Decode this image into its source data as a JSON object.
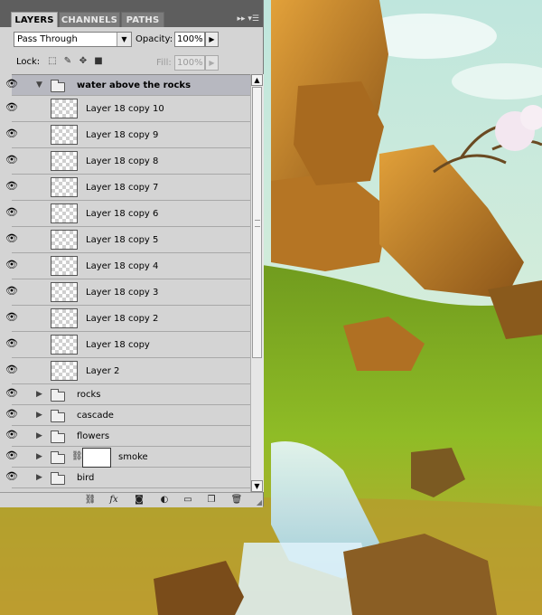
{
  "tabs": [
    {
      "label": "LAYERS",
      "active": true
    },
    {
      "label": "CHANNELS",
      "active": false
    },
    {
      "label": "PATHS",
      "active": false
    }
  ],
  "panel_menu_icon": "panel-menu-icon",
  "blend_mode": "Pass Through",
  "opacity": {
    "label": "Opacity:",
    "value": "100%"
  },
  "lock": {
    "label": "Lock:",
    "icons": [
      "lock-transparent-icon",
      "lock-brush-icon",
      "lock-move-icon",
      "lock-all-icon"
    ]
  },
  "fill": {
    "label": "Fill:",
    "value": "100%"
  },
  "layers": [
    {
      "type": "group",
      "name": "water above the rocks",
      "expanded": true,
      "selected": true,
      "visible": true
    },
    {
      "type": "layer",
      "name": "Layer 18 copy 10",
      "visible": true
    },
    {
      "type": "layer",
      "name": "Layer 18 copy 9",
      "visible": true
    },
    {
      "type": "layer",
      "name": "Layer 18 copy 8",
      "visible": true
    },
    {
      "type": "layer",
      "name": "Layer 18 copy 7",
      "visible": true
    },
    {
      "type": "layer",
      "name": "Layer 18 copy 6",
      "visible": true
    },
    {
      "type": "layer",
      "name": "Layer 18 copy 5",
      "visible": true
    },
    {
      "type": "layer",
      "name": "Layer 18 copy 4",
      "visible": true
    },
    {
      "type": "layer",
      "name": "Layer 18 copy 3",
      "visible": true
    },
    {
      "type": "layer",
      "name": "Layer 18 copy 2",
      "visible": true
    },
    {
      "type": "layer",
      "name": "Layer 18 copy",
      "visible": true
    },
    {
      "type": "layer",
      "name": "Layer 2",
      "visible": true
    },
    {
      "type": "group",
      "name": "rocks",
      "expanded": false,
      "visible": true
    },
    {
      "type": "group",
      "name": "cascade",
      "expanded": false,
      "visible": true
    },
    {
      "type": "group",
      "name": "flowers",
      "expanded": false,
      "visible": true
    },
    {
      "type": "group",
      "name": "smoke",
      "expanded": false,
      "visible": true,
      "has_mask": true
    },
    {
      "type": "group",
      "name": "bird",
      "expanded": false,
      "visible": true
    }
  ],
  "bottom_icons": [
    "link-layers-icon",
    "fx-icon",
    "add-mask-icon",
    "adjustment-layer-icon",
    "new-group-icon",
    "new-layer-icon",
    "trash-icon"
  ],
  "colors": {
    "panel_bg": "#d4d4d4",
    "tab_bar": "#5e5e5e",
    "selected_row": "#b7b8c0"
  }
}
